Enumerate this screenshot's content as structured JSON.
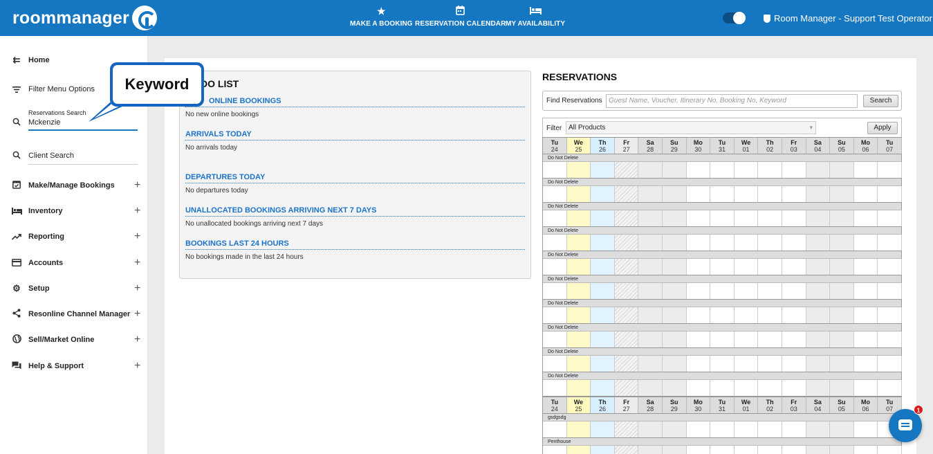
{
  "header": {
    "logo_text": "roommanager",
    "nav": [
      {
        "label": "MAKE A BOOKING",
        "icon": "star-icon"
      },
      {
        "label": "RESERVATION CALENDAR",
        "icon": "calendar-icon"
      },
      {
        "label": "MY AVAILABILITY",
        "icon": "bed-icon"
      }
    ],
    "operator": "Room Manager - Support Test Operator"
  },
  "sidebar": {
    "home": "Home",
    "filter_menu": "Filter Menu Options",
    "res_search_label": "Reservations Search",
    "res_search_value": "Mckenzie",
    "client_search": "Client Search",
    "items": [
      {
        "label": "Make/Manage Bookings",
        "icon": "calendar-check-icon"
      },
      {
        "label": "Inventory",
        "icon": "bed-icon"
      },
      {
        "label": "Reporting",
        "icon": "trending-up-icon"
      },
      {
        "label": "Accounts",
        "icon": "credit-card-icon"
      },
      {
        "label": "Setup",
        "icon": "gear-icon"
      },
      {
        "label": "Resonline Channel Manager",
        "icon": "share-icon"
      },
      {
        "label": "Sell/Market Online",
        "icon": "globe-icon"
      },
      {
        "label": "Help & Support",
        "icon": "chat-bubbles-icon"
      }
    ]
  },
  "callout": {
    "text": "Keyword"
  },
  "todo": {
    "title": "DO LIST",
    "sections": [
      {
        "heading": "ONLINE BOOKINGS",
        "body": "No new online bookings"
      },
      {
        "heading": "ARRIVALS TODAY",
        "body": "No arrivals today"
      },
      {
        "heading": "DEPARTURES TODAY",
        "body": "No departures today"
      },
      {
        "heading": "UNALLOCATED BOOKINGS ARRIVING NEXT 7 DAYS",
        "body": "No unallocated bookings arriving next 7 days"
      },
      {
        "heading": "BOOKINGS LAST 24 HOURS",
        "body": "No bookings made in the last 24 hours"
      }
    ]
  },
  "reservations": {
    "title": "RESERVATIONS",
    "find_label": "Find Reservations",
    "find_placeholder": "Guest Name, Voucher, Itinerary No, Booking No, Keyword",
    "search_btn": "Search",
    "filter_label": "Filter",
    "filter_value": "All Products",
    "apply_btn": "Apply",
    "days": [
      {
        "day": "Tu",
        "date": "24"
      },
      {
        "day": "We",
        "date": "25"
      },
      {
        "day": "Th",
        "date": "26"
      },
      {
        "day": "Fr",
        "date": "27"
      },
      {
        "day": "Sa",
        "date": "28"
      },
      {
        "day": "Su",
        "date": "29"
      },
      {
        "day": "Mo",
        "date": "30"
      },
      {
        "day": "Tu",
        "date": "31"
      },
      {
        "day": "We",
        "date": "01"
      },
      {
        "day": "Th",
        "date": "02"
      },
      {
        "day": "Fr",
        "date": "03"
      },
      {
        "day": "Sa",
        "date": "04"
      },
      {
        "day": "Su",
        "date": "05"
      },
      {
        "day": "Mo",
        "date": "06"
      },
      {
        "day": "Tu",
        "date": "07"
      }
    ],
    "group1_rooms": [
      "Do Not Delete",
      "Do Not Delete",
      "Do Not Delete",
      "Do Not Delete",
      "Do Not Delete",
      "Do Not Delete",
      "Do Not Delete",
      "Do Not Delete",
      "Do Not Delete",
      "Do Not Delete"
    ],
    "group2_rooms": [
      "gsdgsdg",
      "Penthouse"
    ]
  },
  "chat": {
    "badge": "1"
  }
}
